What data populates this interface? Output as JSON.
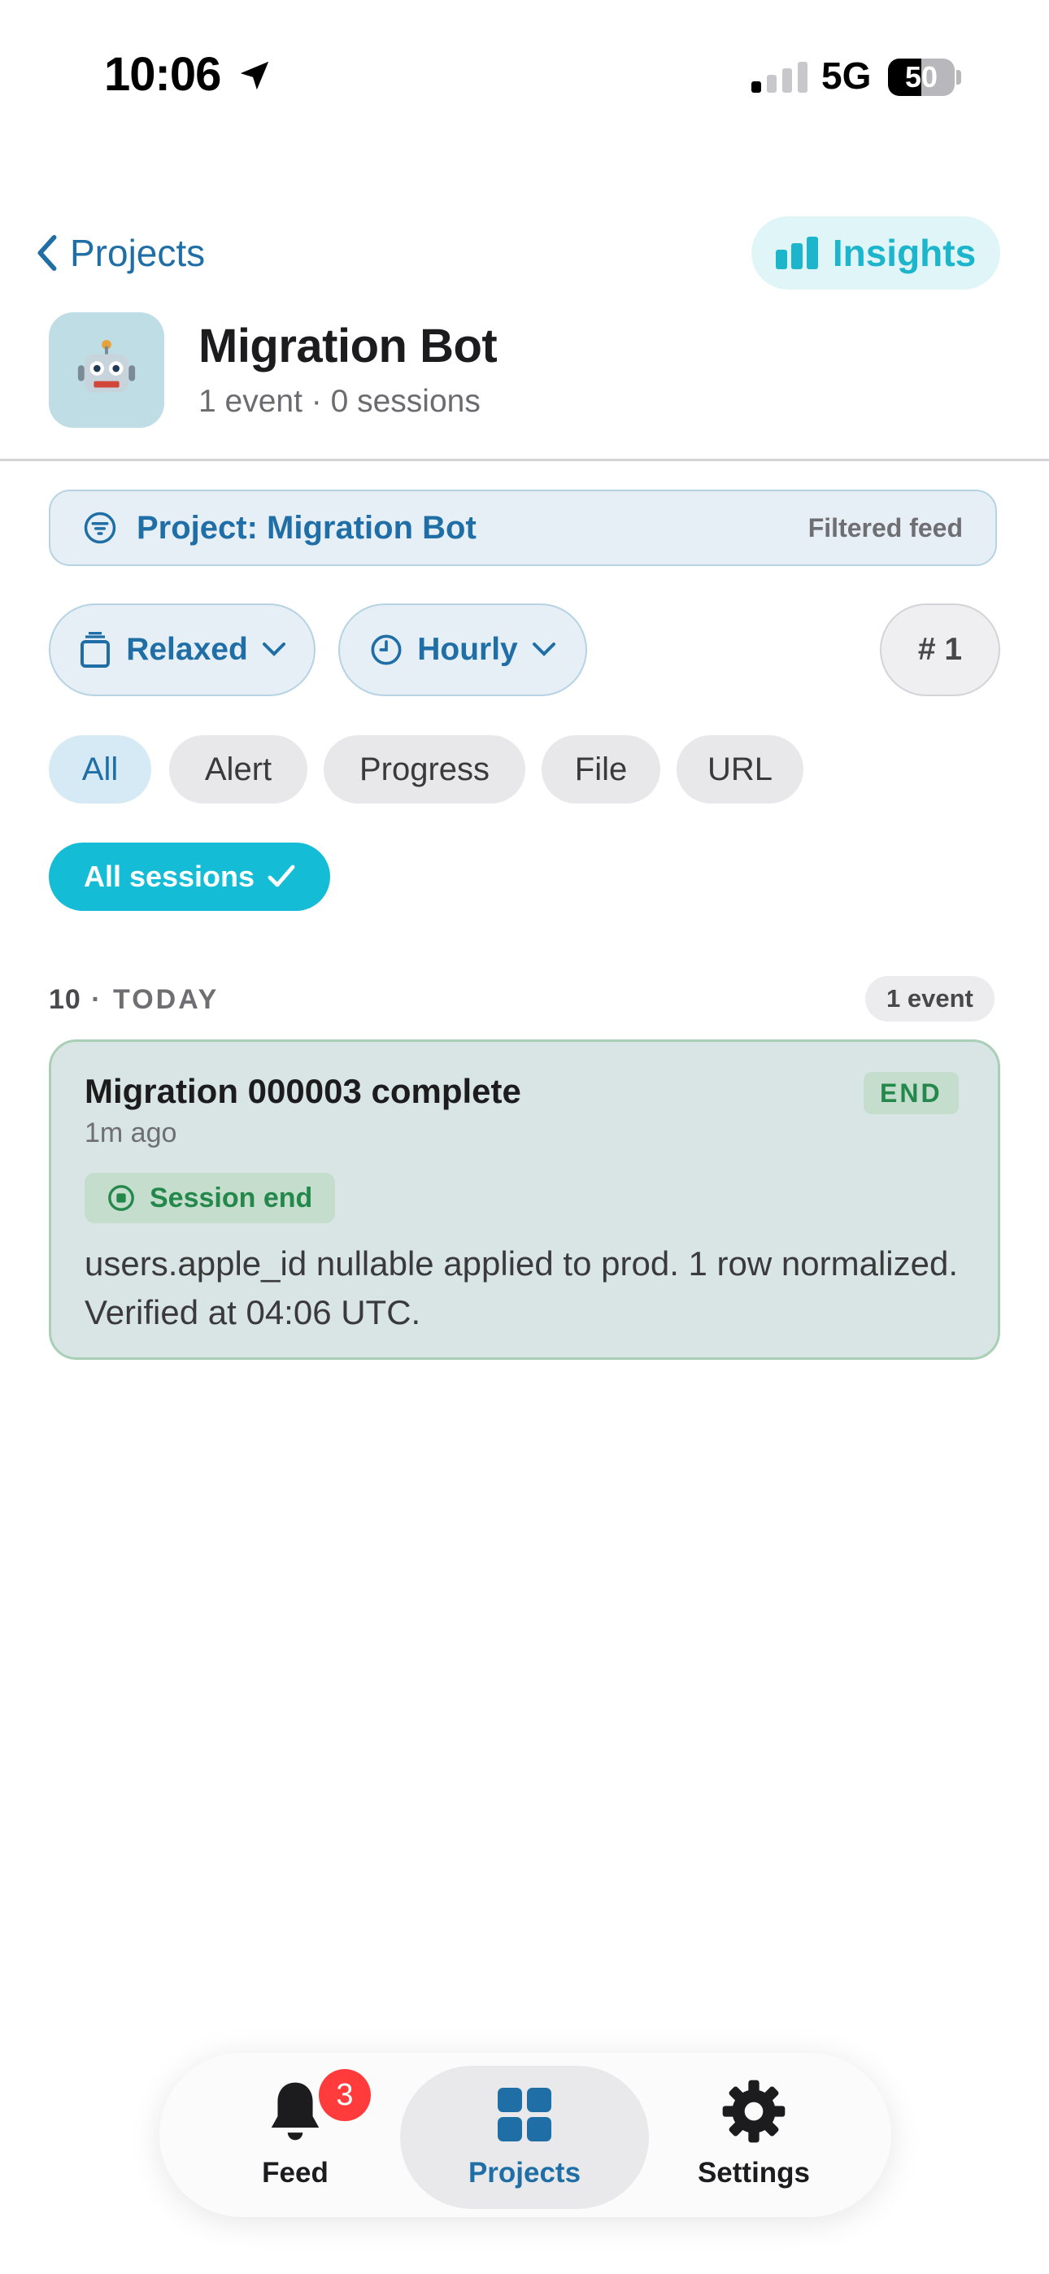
{
  "status_bar": {
    "time": "10:06",
    "network": "5G",
    "battery": "50",
    "icons": [
      "location-arrow-icon",
      "cellular-signal-icon",
      "battery-icon"
    ]
  },
  "nav": {
    "back_label": "Projects",
    "insights_label": "Insights"
  },
  "project": {
    "avatar_icon": "robot-icon",
    "title": "Migration Bot",
    "subtitle": "1 event · 0 sessions"
  },
  "filter_banner": {
    "label": "Project: Migration Bot",
    "right_text": "Filtered feed"
  },
  "controls": {
    "density_label": "Relaxed",
    "grouping_label": "Hourly",
    "count_label": "# 1"
  },
  "type_chips": [
    "All",
    "Alert",
    "Progress",
    "File",
    "URL"
  ],
  "active_chip": "All",
  "sessions_button": "All sessions",
  "group": {
    "hour": "10",
    "day": "· TODAY",
    "count": "1 event"
  },
  "event": {
    "title": "Migration 000003 complete",
    "time": "1m ago",
    "tag": "END",
    "session_label": "Session end",
    "body": "users.apple_id nullable applied to prod. 1 row normalized. Verified at 04:06 UTC."
  },
  "tabs": [
    {
      "label": "Feed",
      "icon": "bell-icon",
      "badge": "3"
    },
    {
      "label": "Projects",
      "icon": "grid-icon"
    },
    {
      "label": "Settings",
      "icon": "gear-icon"
    }
  ],
  "colors": {
    "accent": "#1f6fa6",
    "cyan": "#14bcd6",
    "success": "#24884a",
    "badge": "#ff3b3b"
  }
}
